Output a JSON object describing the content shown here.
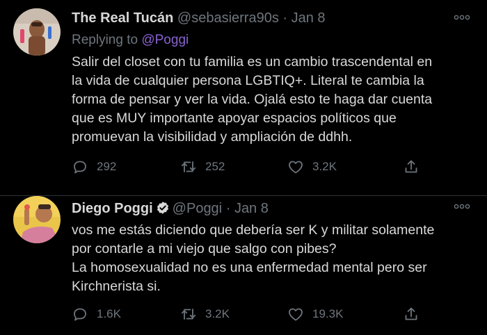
{
  "colors": {
    "background": "#000000",
    "text": "#d9d9d9",
    "secondary": "#6e767d",
    "mention": "#8a63d2",
    "divider": "#2f3336"
  },
  "tweets": [
    {
      "display_name": "The Real Tucán",
      "handle": "@sebasierra90s",
      "separator": "·",
      "date": "Jan 8",
      "verified": false,
      "replying_to_label": "Replying to",
      "replying_to_handle": "@Poggi",
      "text_lines": [
        "Salir del closet con tu familia es un cambio trascendental en",
        "la vida de cualquier persona LGBTIQ+. Literal te cambia la",
        "forma de pensar y ver la vida. Ojalá esto te haga dar cuenta",
        "que es MUY importante apoyar espacios políticos que",
        "promuevan la visibilidad y ampliación de ddhh."
      ],
      "replies": "292",
      "retweets": "252",
      "likes": "3.2K",
      "icons": [
        "reply-icon",
        "retweet-icon",
        "heart-icon",
        "share-icon",
        "more-icon"
      ]
    },
    {
      "display_name": "Diego Poggi",
      "handle": "@Poggi",
      "separator": "·",
      "date": "Jan 8",
      "verified": true,
      "text_lines": [
        "vos me estás diciendo que debería ser K y militar solamente",
        "por contarle a mi viejo que salgo con pibes?",
        "La homosexualidad no es una enfermedad mental pero ser",
        "Kirchnerista si."
      ],
      "replies": "1.6K",
      "retweets": "3.2K",
      "likes": "19.3K",
      "icons": [
        "reply-icon",
        "retweet-icon",
        "heart-icon",
        "share-icon",
        "more-icon",
        "verified-badge-icon"
      ]
    }
  ]
}
